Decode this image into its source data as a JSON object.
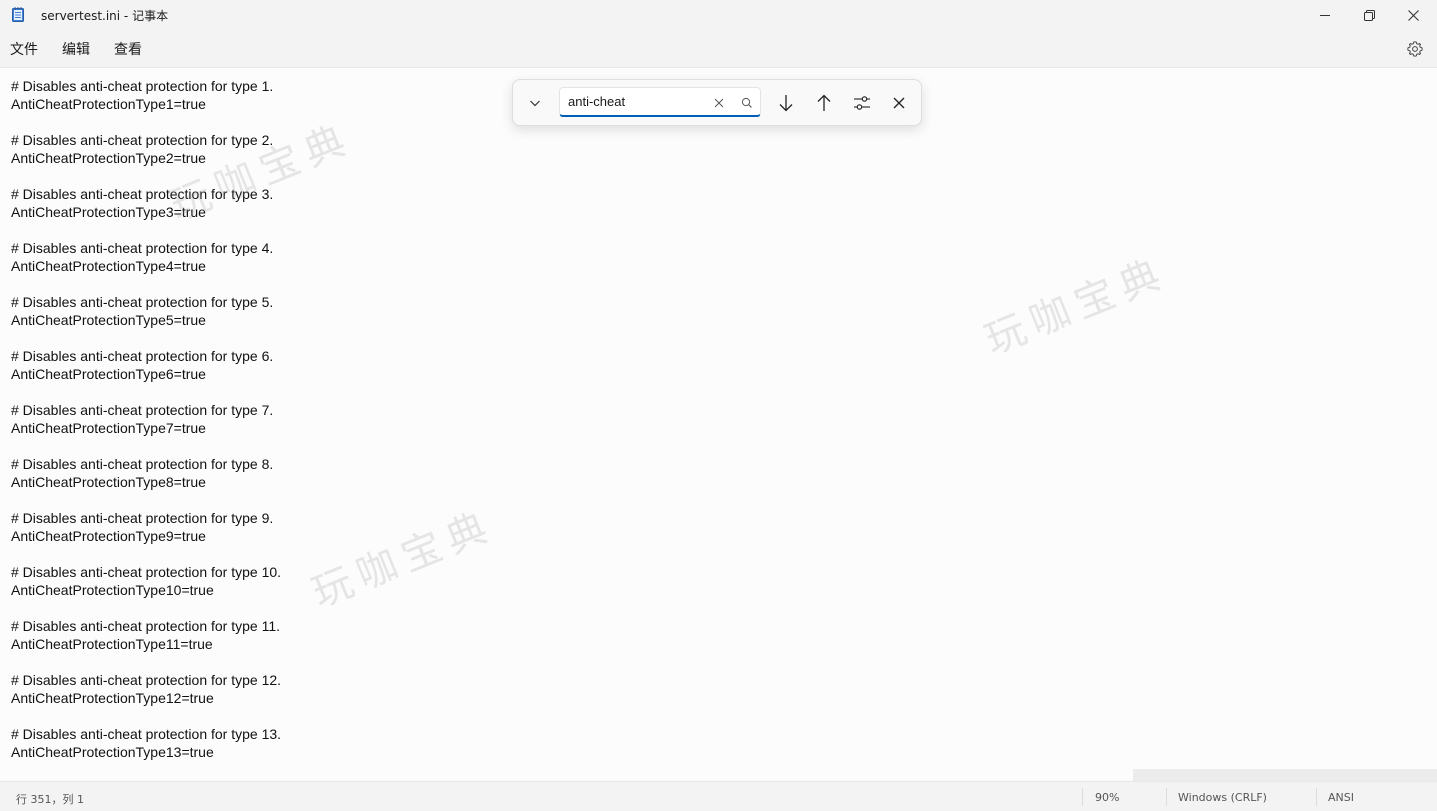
{
  "window": {
    "title": "servertest.ini - 记事本",
    "app_icon": "notepad-icon"
  },
  "menu": {
    "file": "文件",
    "edit": "编辑",
    "view": "查看"
  },
  "editor": {
    "lines": [
      "# Disables anti-cheat protection for type 1.",
      "AntiCheatProtectionType1=true",
      "",
      "# Disables anti-cheat protection for type 2.",
      "AntiCheatProtectionType2=true",
      "",
      "# Disables anti-cheat protection for type 3.",
      "AntiCheatProtectionType3=true",
      "",
      "# Disables anti-cheat protection for type 4.",
      "AntiCheatProtectionType4=true",
      "",
      "# Disables anti-cheat protection for type 5.",
      "AntiCheatProtectionType5=true",
      "",
      "# Disables anti-cheat protection for type 6.",
      "AntiCheatProtectionType6=true",
      "",
      "# Disables anti-cheat protection for type 7.",
      "AntiCheatProtectionType7=true",
      "",
      "# Disables anti-cheat protection for type 8.",
      "AntiCheatProtectionType8=true",
      "",
      "# Disables anti-cheat protection for type 9.",
      "AntiCheatProtectionType9=true",
      "",
      "# Disables anti-cheat protection for type 10.",
      "AntiCheatProtectionType10=true",
      "",
      "# Disables anti-cheat protection for type 11.",
      "AntiCheatProtectionType11=true",
      "",
      "# Disables anti-cheat protection for type 12.",
      "AntiCheatProtectionType12=true",
      "",
      "# Disables anti-cheat protection for type 13.",
      "AntiCheatProtectionType13=true"
    ]
  },
  "watermark": {
    "text": "玩咖宝典"
  },
  "find": {
    "query": "anti-cheat"
  },
  "status": {
    "position": "行 351，列 1",
    "zoom": "90%",
    "line_ending": "Windows (CRLF)",
    "encoding": "ANSI"
  },
  "colors": {
    "accent": "#005fb8",
    "background": "#fafafa",
    "chrome": "#f3f3f3"
  }
}
